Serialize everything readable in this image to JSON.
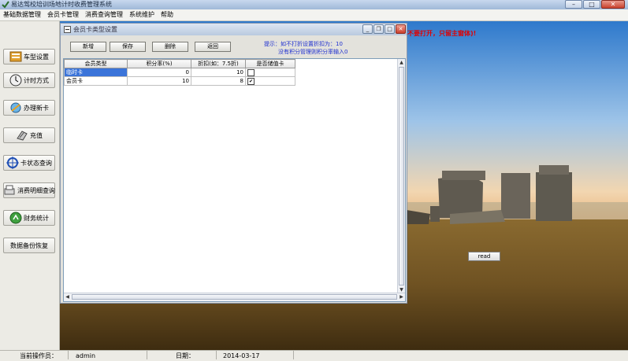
{
  "app": {
    "title": "易达驾校培训场地计时收费管理系统",
    "controls": {
      "minimize": "–",
      "maximize": "□",
      "close": "✕"
    }
  },
  "menubar": [
    "基础数据管理",
    "会员卡管理",
    "消费查询管理",
    "系统维护",
    "帮助"
  ],
  "sidebar": {
    "items": [
      {
        "label": "车型设置",
        "icon": "car-type-icon"
      },
      {
        "label": "计时方式",
        "icon": "clock-icon"
      },
      {
        "label": "办理新卡",
        "icon": "new-card-icon"
      },
      {
        "label": "充值",
        "icon": "recharge-icon"
      },
      {
        "label": "卡状态查询",
        "icon": "card-status-icon"
      },
      {
        "label": "消费明细查询",
        "icon": "consumption-detail-icon"
      },
      {
        "label": "财务统计",
        "icon": "finance-icon"
      },
      {
        "label": "数据备份恢复",
        "icon": ""
      }
    ]
  },
  "child_window": {
    "title": "会员卡类型设置",
    "controls": {
      "minimize": "_",
      "maximize": "□",
      "restore": "❐",
      "close": "✕"
    },
    "toolbar": {
      "add": "新增",
      "save": "保存",
      "delete": "删除",
      "back": "返回"
    },
    "tip_line1": "提示：如不打折设置折扣为：10",
    "tip_line2": "没有积分管理则积分率输入0",
    "table": {
      "columns": [
        "会员类型",
        "积分率(%)",
        "折扣(如：7.5折)",
        "是否储值卡"
      ],
      "rows": [
        {
          "type": "临时卡",
          "points_rate": "0",
          "discount": "10",
          "stored_value": false,
          "selected": true
        },
        {
          "type": "会员卡",
          "points_rate": "10",
          "discount": "8",
          "stored_value": true,
          "selected": false
        }
      ]
    }
  },
  "background": {
    "warning": "不要打开，只留主窗体)!",
    "read_button": "read"
  },
  "statusbar": {
    "operator_label": "当前操作员：",
    "operator": "admin",
    "date_label": "日期：",
    "date": "2014-03-17"
  },
  "colors": {
    "sky_top": "#2e79cc",
    "sky_bottom": "#e8b37e",
    "grass": "#7a5a2a",
    "warning": "#e00000",
    "tip": "#1e2fd0",
    "selection": "#3b74d9"
  }
}
